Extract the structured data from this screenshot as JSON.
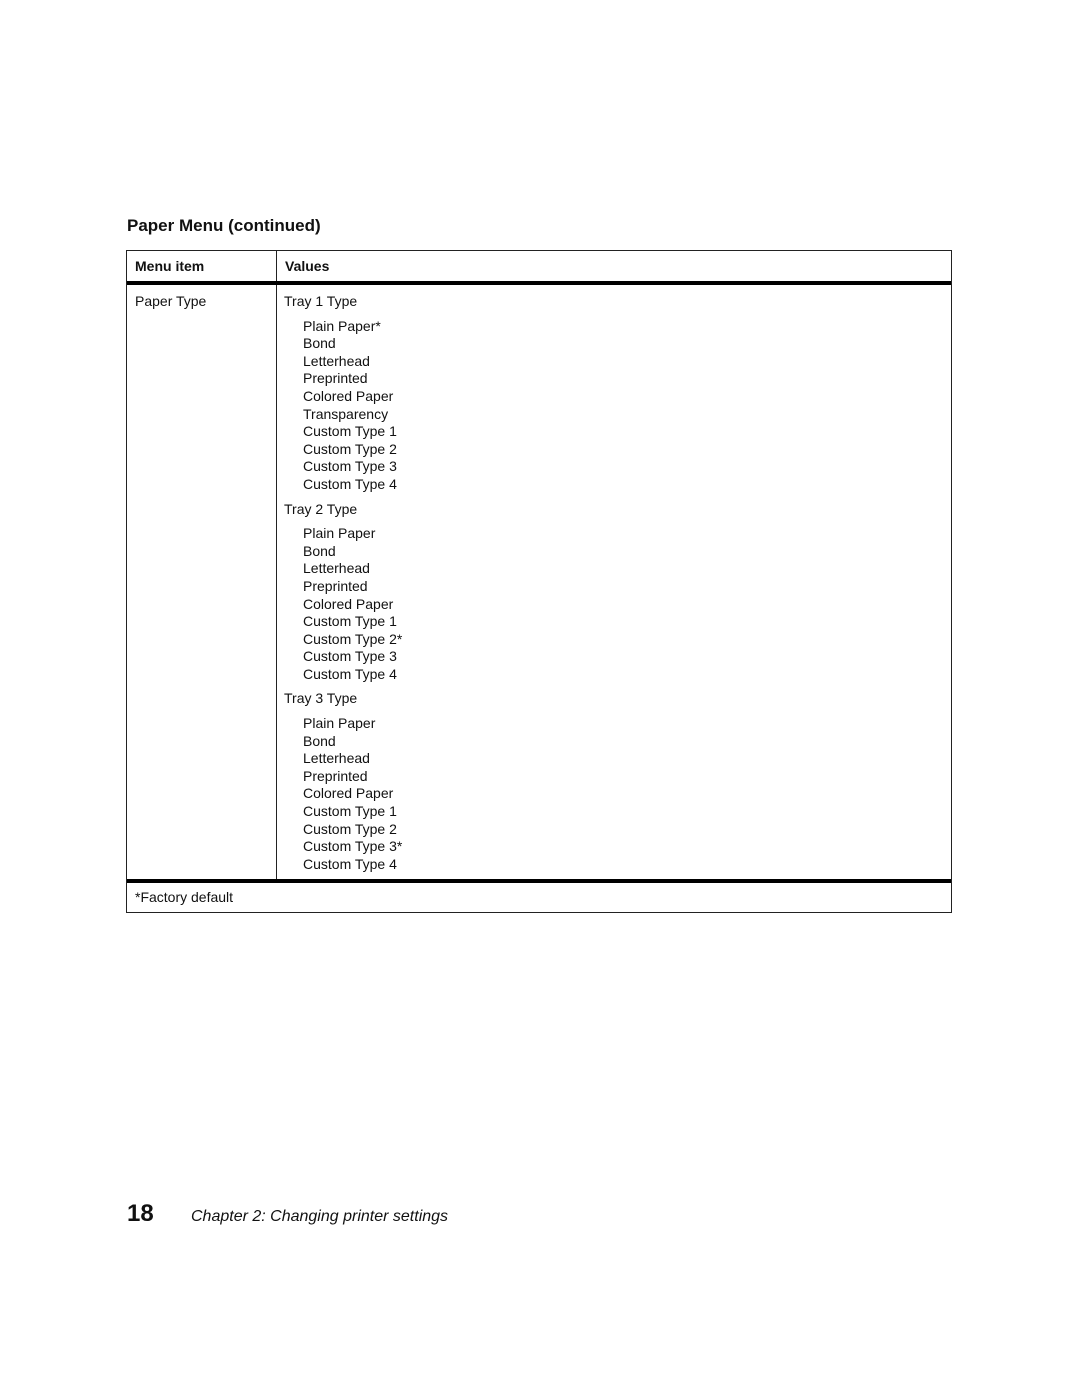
{
  "section": {
    "title": "Paper Menu (continued)"
  },
  "table": {
    "headers": [
      "Menu item",
      "Values"
    ],
    "row": {
      "menu_item": "Paper Type",
      "groups": [
        {
          "title": "Tray 1 Type",
          "options": [
            "Plain Paper*",
            "Bond",
            "Letterhead",
            "Preprinted",
            "Colored Paper",
            "Transparency",
            "Custom Type 1",
            "Custom Type 2",
            "Custom Type 3",
            "Custom Type 4"
          ]
        },
        {
          "title": "Tray 2 Type",
          "options": [
            "Plain Paper",
            "Bond",
            "Letterhead",
            "Preprinted",
            "Colored Paper",
            "Custom Type 1",
            "Custom Type 2*",
            "Custom Type 3",
            "Custom Type 4"
          ]
        },
        {
          "title": "Tray 3 Type",
          "options": [
            "Plain Paper",
            "Bond",
            "Letterhead",
            "Preprinted",
            "Colored Paper",
            "Custom Type 1",
            "Custom Type 2",
            "Custom Type 3*",
            "Custom Type 4"
          ]
        }
      ]
    },
    "footnote": "*Factory default"
  },
  "footer": {
    "page_number": "18",
    "chapter": "Chapter 2: Changing printer settings"
  }
}
